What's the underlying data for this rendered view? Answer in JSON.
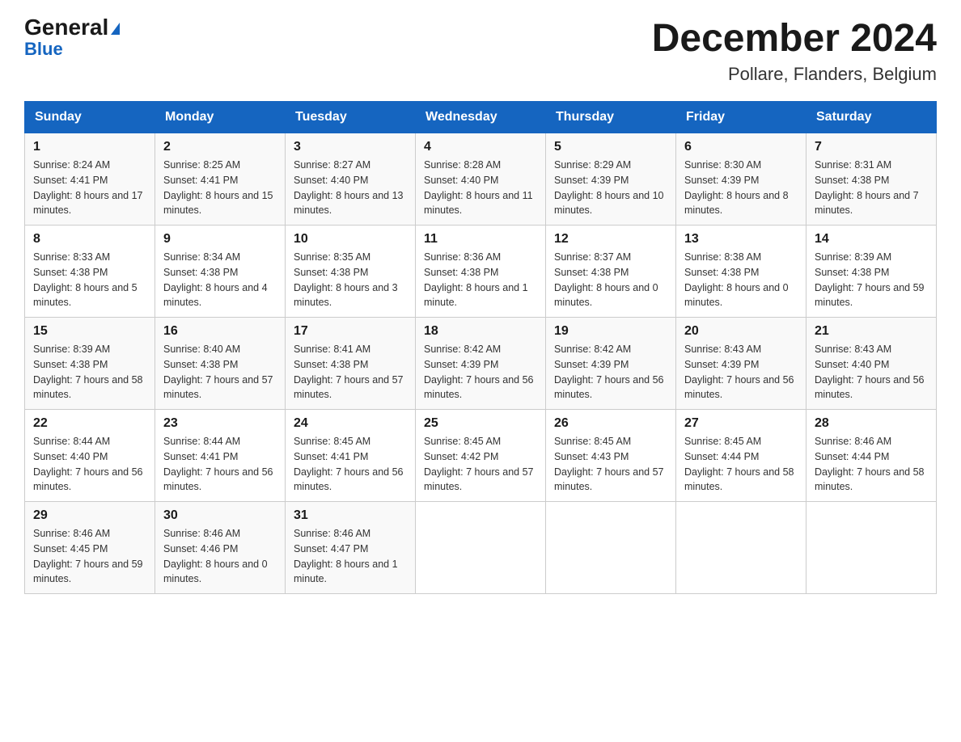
{
  "header": {
    "logo_general": "General",
    "logo_blue": "Blue",
    "month_year": "December 2024",
    "location": "Pollare, Flanders, Belgium"
  },
  "days_of_week": [
    "Sunday",
    "Monday",
    "Tuesday",
    "Wednesday",
    "Thursday",
    "Friday",
    "Saturday"
  ],
  "weeks": [
    [
      {
        "day": "1",
        "sunrise": "8:24 AM",
        "sunset": "4:41 PM",
        "daylight": "8 hours and 17 minutes."
      },
      {
        "day": "2",
        "sunrise": "8:25 AM",
        "sunset": "4:41 PM",
        "daylight": "8 hours and 15 minutes."
      },
      {
        "day": "3",
        "sunrise": "8:27 AM",
        "sunset": "4:40 PM",
        "daylight": "8 hours and 13 minutes."
      },
      {
        "day": "4",
        "sunrise": "8:28 AM",
        "sunset": "4:40 PM",
        "daylight": "8 hours and 11 minutes."
      },
      {
        "day": "5",
        "sunrise": "8:29 AM",
        "sunset": "4:39 PM",
        "daylight": "8 hours and 10 minutes."
      },
      {
        "day": "6",
        "sunrise": "8:30 AM",
        "sunset": "4:39 PM",
        "daylight": "8 hours and 8 minutes."
      },
      {
        "day": "7",
        "sunrise": "8:31 AM",
        "sunset": "4:38 PM",
        "daylight": "8 hours and 7 minutes."
      }
    ],
    [
      {
        "day": "8",
        "sunrise": "8:33 AM",
        "sunset": "4:38 PM",
        "daylight": "8 hours and 5 minutes."
      },
      {
        "day": "9",
        "sunrise": "8:34 AM",
        "sunset": "4:38 PM",
        "daylight": "8 hours and 4 minutes."
      },
      {
        "day": "10",
        "sunrise": "8:35 AM",
        "sunset": "4:38 PM",
        "daylight": "8 hours and 3 minutes."
      },
      {
        "day": "11",
        "sunrise": "8:36 AM",
        "sunset": "4:38 PM",
        "daylight": "8 hours and 1 minute."
      },
      {
        "day": "12",
        "sunrise": "8:37 AM",
        "sunset": "4:38 PM",
        "daylight": "8 hours and 0 minutes."
      },
      {
        "day": "13",
        "sunrise": "8:38 AM",
        "sunset": "4:38 PM",
        "daylight": "8 hours and 0 minutes."
      },
      {
        "day": "14",
        "sunrise": "8:39 AM",
        "sunset": "4:38 PM",
        "daylight": "7 hours and 59 minutes."
      }
    ],
    [
      {
        "day": "15",
        "sunrise": "8:39 AM",
        "sunset": "4:38 PM",
        "daylight": "7 hours and 58 minutes."
      },
      {
        "day": "16",
        "sunrise": "8:40 AM",
        "sunset": "4:38 PM",
        "daylight": "7 hours and 57 minutes."
      },
      {
        "day": "17",
        "sunrise": "8:41 AM",
        "sunset": "4:38 PM",
        "daylight": "7 hours and 57 minutes."
      },
      {
        "day": "18",
        "sunrise": "8:42 AM",
        "sunset": "4:39 PM",
        "daylight": "7 hours and 56 minutes."
      },
      {
        "day": "19",
        "sunrise": "8:42 AM",
        "sunset": "4:39 PM",
        "daylight": "7 hours and 56 minutes."
      },
      {
        "day": "20",
        "sunrise": "8:43 AM",
        "sunset": "4:39 PM",
        "daylight": "7 hours and 56 minutes."
      },
      {
        "day": "21",
        "sunrise": "8:43 AM",
        "sunset": "4:40 PM",
        "daylight": "7 hours and 56 minutes."
      }
    ],
    [
      {
        "day": "22",
        "sunrise": "8:44 AM",
        "sunset": "4:40 PM",
        "daylight": "7 hours and 56 minutes."
      },
      {
        "day": "23",
        "sunrise": "8:44 AM",
        "sunset": "4:41 PM",
        "daylight": "7 hours and 56 minutes."
      },
      {
        "day": "24",
        "sunrise": "8:45 AM",
        "sunset": "4:41 PM",
        "daylight": "7 hours and 56 minutes."
      },
      {
        "day": "25",
        "sunrise": "8:45 AM",
        "sunset": "4:42 PM",
        "daylight": "7 hours and 57 minutes."
      },
      {
        "day": "26",
        "sunrise": "8:45 AM",
        "sunset": "4:43 PM",
        "daylight": "7 hours and 57 minutes."
      },
      {
        "day": "27",
        "sunrise": "8:45 AM",
        "sunset": "4:44 PM",
        "daylight": "7 hours and 58 minutes."
      },
      {
        "day": "28",
        "sunrise": "8:46 AM",
        "sunset": "4:44 PM",
        "daylight": "7 hours and 58 minutes."
      }
    ],
    [
      {
        "day": "29",
        "sunrise": "8:46 AM",
        "sunset": "4:45 PM",
        "daylight": "7 hours and 59 minutes."
      },
      {
        "day": "30",
        "sunrise": "8:46 AM",
        "sunset": "4:46 PM",
        "daylight": "8 hours and 0 minutes."
      },
      {
        "day": "31",
        "sunrise": "8:46 AM",
        "sunset": "4:47 PM",
        "daylight": "8 hours and 1 minute."
      },
      null,
      null,
      null,
      null
    ]
  ]
}
